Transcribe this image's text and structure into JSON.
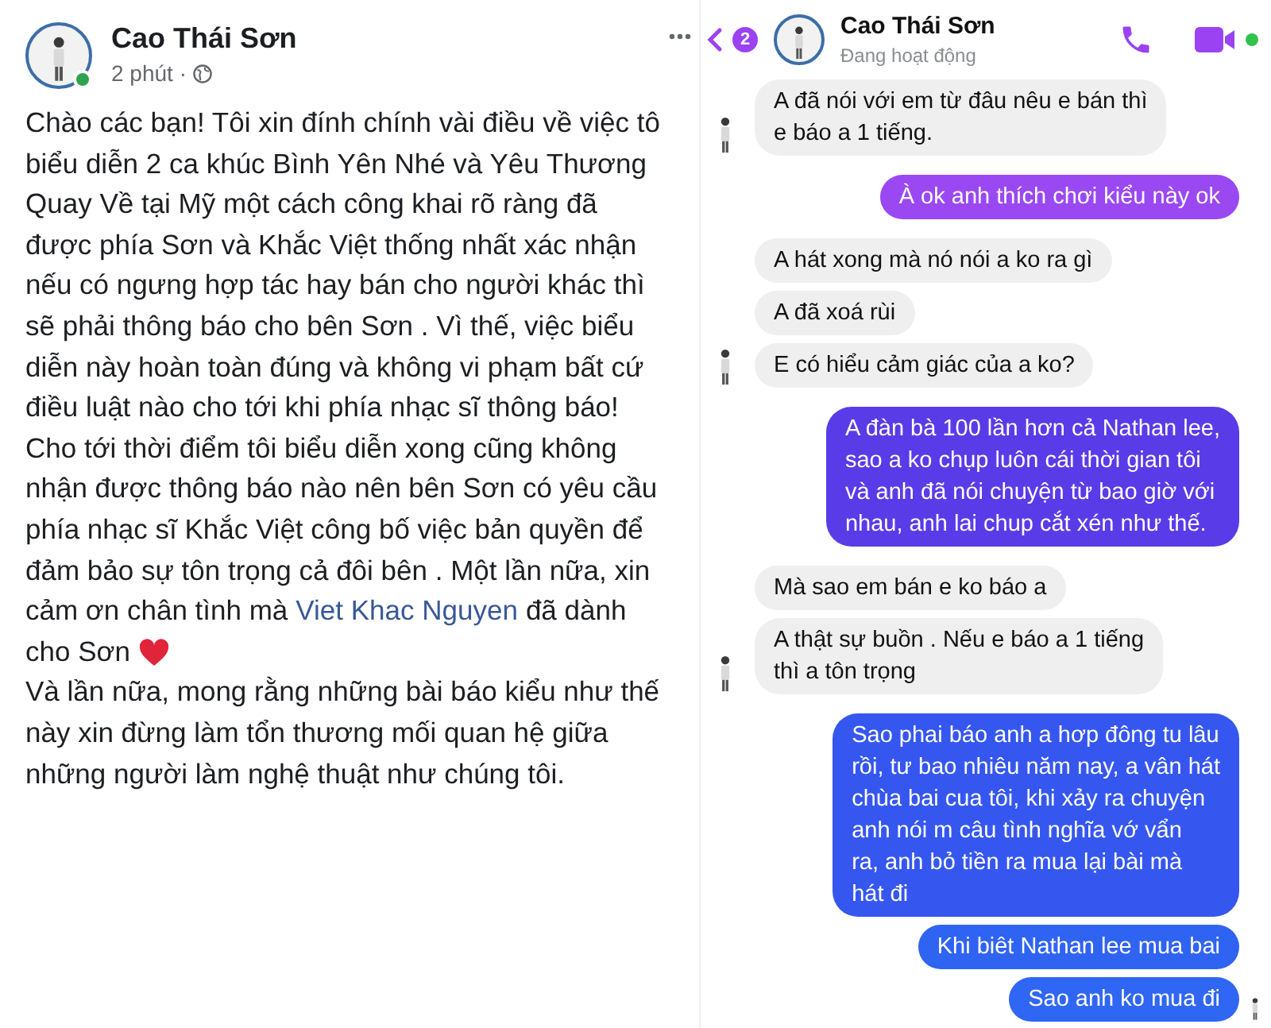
{
  "post": {
    "author": "Cao Thái Sơn",
    "online": true,
    "time": "2 phút ·",
    "lines": [
      [
        {
          "kind": "text",
          "text": "Chào các bạn! Tôi xin đính chính vài điều về việc tô"
        }
      ],
      [
        {
          "kind": "text",
          "text": "biểu diễn 2 ca khúc Bình Yên Nhé và Yêu Thương"
        }
      ],
      [
        {
          "kind": "text",
          "text": "Quay Về tại Mỹ một cách công khai rõ ràng đã"
        }
      ],
      [
        {
          "kind": "text",
          "text": "được phía Sơn và Khắc Việt thống nhất xác nhận"
        }
      ],
      [
        {
          "kind": "text",
          "text": "nếu có ngưng hợp tác hay bán cho người khác thì"
        }
      ],
      [
        {
          "kind": "text",
          "text": "sẽ phải thông báo cho bên Sơn . Vì thế, việc biểu"
        }
      ],
      [
        {
          "kind": "text",
          "text": "diễn này hoàn toàn đúng và không vi phạm bất cứ"
        }
      ],
      [
        {
          "kind": "text",
          "text": "điều luật nào cho tới khi phía nhạc sĩ thông báo!"
        }
      ],
      [
        {
          "kind": "text",
          "text": "Cho tới thời điểm tôi biểu diễn xong cũng không"
        }
      ],
      [
        {
          "kind": "text",
          "text": "nhận được thông báo nào nên bên Sơn có yêu cầu"
        }
      ],
      [
        {
          "kind": "text",
          "text": "phía nhạc sĩ Khắc Việt công bố việc bản quyền để"
        }
      ],
      [
        {
          "kind": "text",
          "text": "đảm bảo sự tôn trọng cả đôi bên . Một lần nữa, xin"
        }
      ],
      [
        {
          "kind": "text",
          "text": "cảm ơn chân tình mà"
        },
        {
          "kind": "link",
          "text": "Viet Khac Nguyen"
        },
        {
          "kind": "text",
          "text": "đã dành"
        }
      ],
      [
        {
          "kind": "text",
          "text": "cho Sơn"
        },
        {
          "kind": "heart"
        }
      ],
      [
        {
          "kind": "text",
          "text": "Và lần nữa, mong rằng những bài báo kiểu như thế"
        }
      ],
      [
        {
          "kind": "text",
          "text": "này xin đừng làm tổn thương mối quan hệ giữa"
        }
      ],
      [
        {
          "kind": "text",
          "text": "những người làm nghệ thuật như chúng tôi."
        }
      ]
    ]
  },
  "chat": {
    "unread": "2",
    "name": "Cao Thái Sơn",
    "status": "Đang hoạt động",
    "online": true,
    "messages": [
      {
        "kind": "incoming",
        "avatar": true,
        "lines": [
          "A đã nói với em từ đâu nêu e bán thì",
          "e báo a 1 tiếng."
        ]
      },
      {
        "kind": "outgoing",
        "color": "#9a48f2",
        "seen": false,
        "lines": [
          "À ok anh thích chơi kiểu này ok"
        ]
      },
      {
        "kind": "incoming",
        "avatar": false,
        "lines": [
          "A hát xong mà nó nói a ko ra gì"
        ]
      },
      {
        "kind": "incoming",
        "avatar": false,
        "lines": [
          "A đã xoá rùi"
        ]
      },
      {
        "kind": "incoming",
        "avatar": true,
        "lines": [
          "E có hiểu cảm giác của a ko?"
        ]
      },
      {
        "kind": "outgoing",
        "color": "#5a3be8",
        "seen": false,
        "lines": [
          "A đàn bà 100 lần hơn cả Nathan lee,",
          "sao a ko chụp luôn cái thời gian tôi",
          "và anh đã nói chuyện từ bao giờ với",
          "nhau, anh lai chup cắt xén như thế."
        ]
      },
      {
        "kind": "incoming",
        "avatar": false,
        "lines": [
          "Mà sao em bán e ko báo a"
        ]
      },
      {
        "kind": "incoming",
        "avatar": true,
        "lines": [
          "A thật sự buồn . Nếu e báo a 1 tiếng",
          "thì a tôn trọng"
        ]
      },
      {
        "kind": "outgoing",
        "color": "#3557f0",
        "seen": false,
        "lines": [
          "Sao phai báo anh a hơp đông tu lâu",
          "rồi, tư bao nhiêu năm nay, a vân hát",
          "chùa bai cua tôi, khi xảy ra chuyện",
          "anh nói m câu tình nghĩa vớ vẩn",
          "ra, anh bỏ tiền ra mua lại bài mà",
          "hát đi"
        ]
      },
      {
        "kind": "outgoing",
        "color": "#2f63f2",
        "seen": false,
        "lines": [
          "Khi biêt Nathan lee mua bai"
        ]
      },
      {
        "kind": "outgoing",
        "color": "#2f66f3",
        "lines": [
          "Sao anh ko mua đi"
        ],
        "seen": true
      }
    ]
  }
}
